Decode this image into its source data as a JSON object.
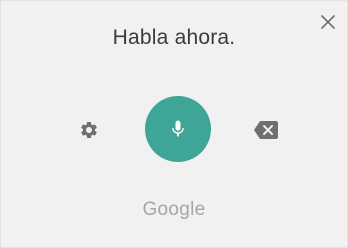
{
  "dialog": {
    "prompt_text": "Habla ahora.",
    "brand_text": "Google"
  },
  "icons": {
    "close": "close-icon",
    "settings": "gear-icon",
    "microphone": "microphone-icon",
    "backspace": "backspace-icon"
  },
  "colors": {
    "background": "#f1f1f1",
    "mic_button": "#3fa596",
    "icon_gray": "#6f6f6f",
    "prompt_text": "#3b3b3b",
    "brand_text": "#a6a6a6"
  }
}
